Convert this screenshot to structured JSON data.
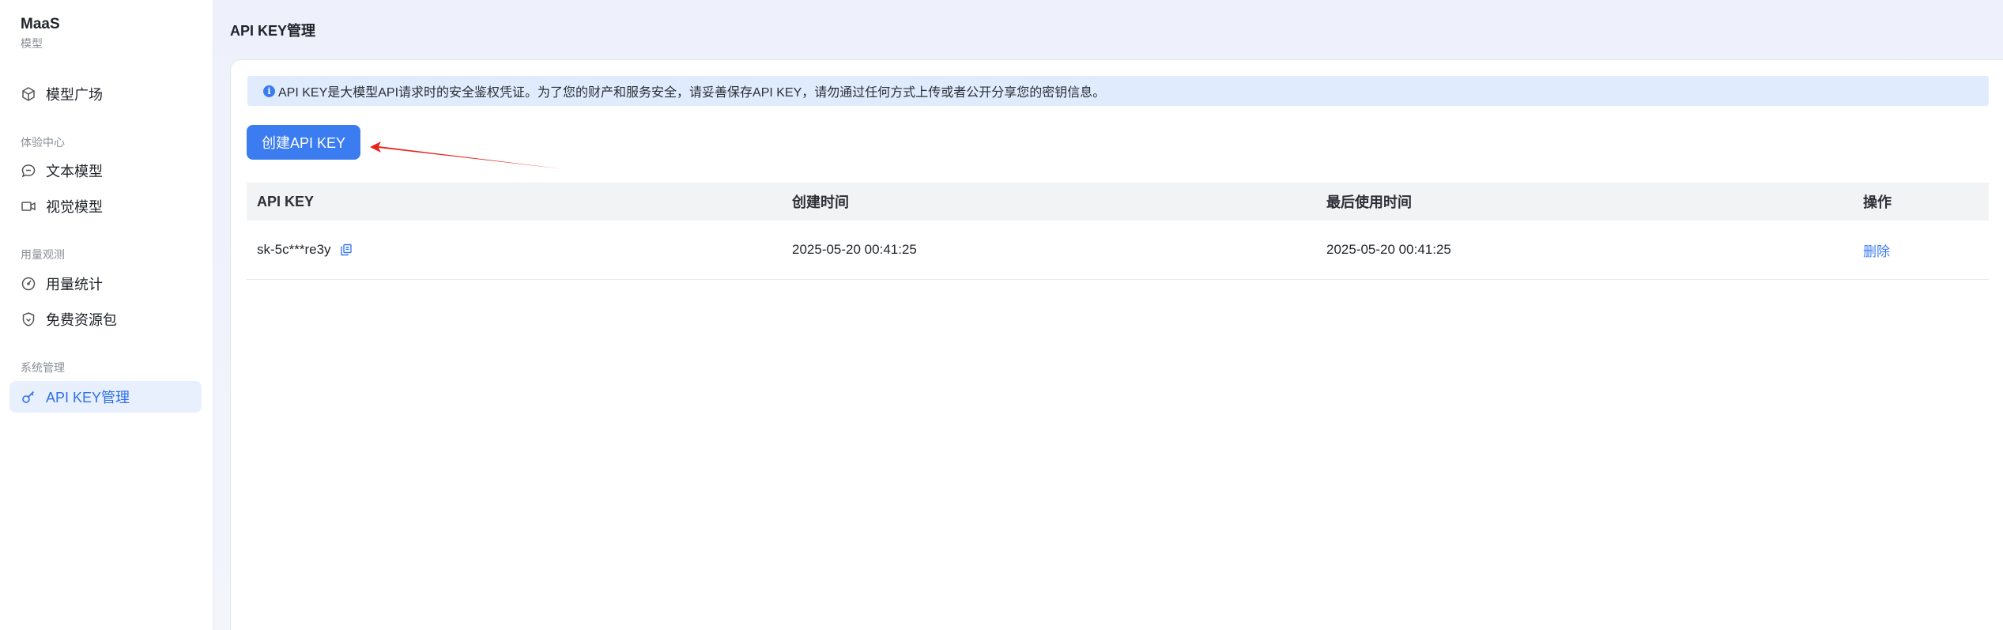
{
  "sidebar": {
    "brand": "MaaS",
    "groups": [
      {
        "title": "模型",
        "items": [
          {
            "label": "模型广场",
            "icon": "cube-icon"
          }
        ]
      },
      {
        "title": "体验中心",
        "items": [
          {
            "label": "文本模型",
            "icon": "chat-bubble-icon"
          },
          {
            "label": "视觉模型",
            "icon": "video-camera-icon"
          }
        ]
      },
      {
        "title": "用量观测",
        "items": [
          {
            "label": "用量统计",
            "icon": "gauge-icon"
          },
          {
            "label": "免费资源包",
            "icon": "shield-icon"
          }
        ]
      },
      {
        "title": "系统管理",
        "items": [
          {
            "label": "API KEY管理",
            "icon": "key-icon",
            "active": true
          }
        ]
      }
    ]
  },
  "main": {
    "page_title": "API KEY管理",
    "notice": "API KEY是大模型API请求时的安全鉴权凭证。为了您的财产和服务安全，请妥善保存API KEY，请勿通过任何方式上传或者公开分享您的密钥信息。",
    "create_button": "创建API KEY",
    "table": {
      "columns": [
        "API KEY",
        "创建时间",
        "最后使用时间",
        "操作"
      ],
      "rows": [
        {
          "api_key": "sk-5c***re3y",
          "created": "2025-05-20 00:41:25",
          "last_used": "2025-05-20 00:41:25",
          "action": "删除"
        }
      ]
    }
  },
  "colors": {
    "accent": "#3b7cf0",
    "arrow": "#e8231c",
    "active_bg": "#e8f0fd"
  }
}
